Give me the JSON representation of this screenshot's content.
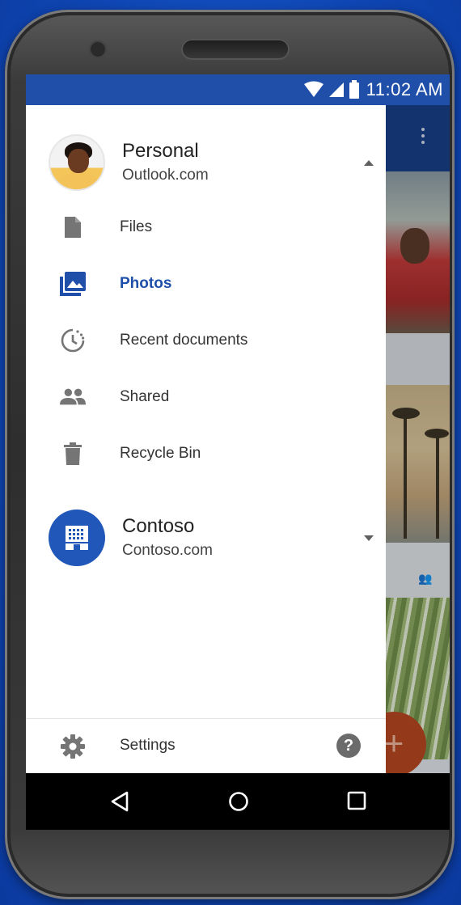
{
  "status_bar": {
    "time": "11:02 AM"
  },
  "drawer": {
    "personal_account": {
      "name": "Personal",
      "subtitle": "Outlook.com"
    },
    "nav_items": [
      {
        "label": "Files",
        "icon": "file-icon",
        "active": false
      },
      {
        "label": "Photos",
        "icon": "photos-icon",
        "active": true
      },
      {
        "label": "Recent documents",
        "icon": "recent-icon",
        "active": false
      },
      {
        "label": "Shared",
        "icon": "people-icon",
        "active": false
      },
      {
        "label": "Recycle Bin",
        "icon": "trash-icon",
        "active": false
      }
    ],
    "business_account": {
      "name": "Contoso",
      "subtitle": "Contoso.com"
    },
    "footer": {
      "settings_label": "Settings",
      "help_label": "?"
    }
  },
  "colors": {
    "accent": "#1f4fa8",
    "status_bar": "#1f4fa8",
    "org_avatar": "#2157b8"
  },
  "system_nav": {
    "back": "back-icon",
    "home": "home-icon",
    "recents": "recents-icon"
  }
}
